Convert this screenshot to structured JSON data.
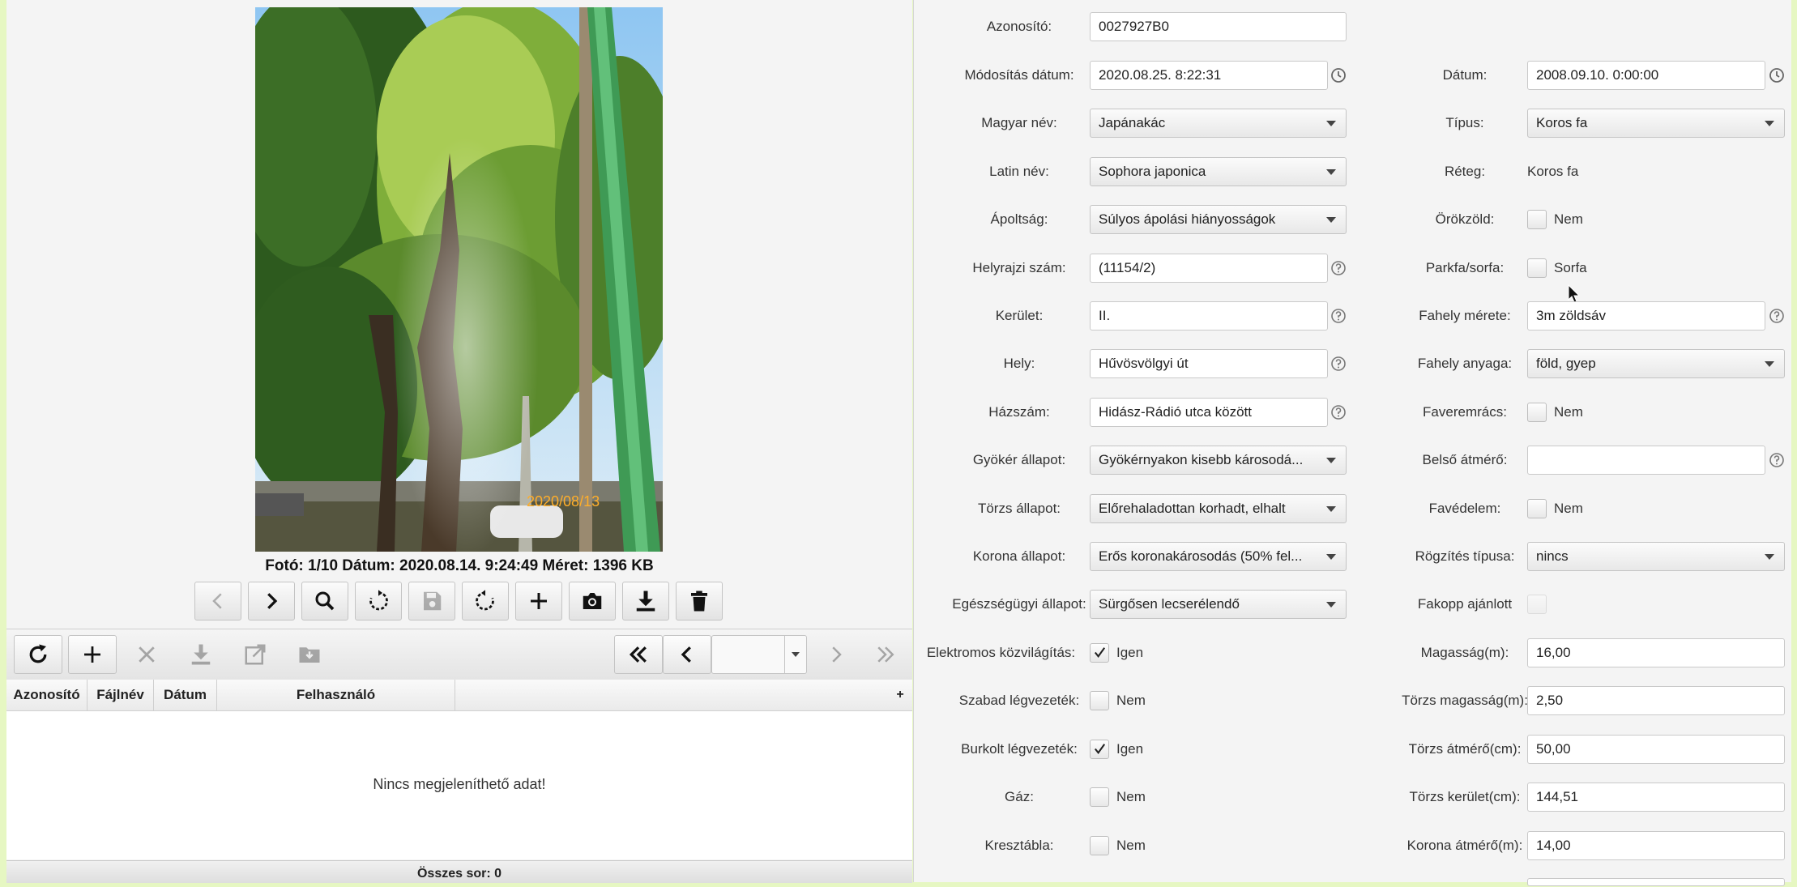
{
  "photo": {
    "stamp": "2020/08/13",
    "caption": "Fotó: 1/10 Dátum: 2020.08.14. 9:24:49 Méret: 1396 KB"
  },
  "photo_toolbar": [
    "chevron-left-icon",
    "chevron-right-icon",
    "search-icon",
    "rotate-right-icon",
    "save-icon",
    "rotate-left-icon",
    "plus-icon",
    "camera-icon",
    "download-icon",
    "trash-icon"
  ],
  "grid": {
    "toolbar_icons": [
      "refresh-icon",
      "plus-icon",
      "close-icon",
      "download-icon",
      "external-link-icon",
      "folder-download-icon"
    ],
    "pager_icons": [
      "double-chevron-left-icon",
      "chevron-left-icon",
      "chevron-right-icon",
      "double-chevron-right-icon"
    ],
    "columns": [
      "Azonosító",
      "Fájlnév",
      "Dátum",
      "Felhasználó"
    ],
    "add_column": "+",
    "empty_text": "Nincs megjeleníthető adat!",
    "footer": "Összes sor: 0"
  },
  "form": {
    "azonosito": {
      "label": "Azonosító:",
      "value": "0027927B0"
    },
    "modositas_datum": {
      "label": "Módosítás dátum:",
      "value": "2020.08.25. 8:22:31"
    },
    "datum": {
      "label": "Dátum:",
      "value": "2008.09.10. 0:00:00"
    },
    "magyar_nev": {
      "label": "Magyar név:",
      "value": "Japánakác"
    },
    "tipus": {
      "label": "Típus:",
      "value": "Koros fa"
    },
    "latin_nev": {
      "label": "Latin név:",
      "value": "Sophora japonica"
    },
    "reteg": {
      "label": "Réteg:",
      "value": "Koros fa"
    },
    "apoltsag": {
      "label": "Ápoltság:",
      "value": "Súlyos ápolási hiányosságok"
    },
    "orokzold": {
      "label": "Örökzöld:",
      "checkbox": "Nem",
      "checked": false
    },
    "helyrajzi_szam": {
      "label": "Helyrajzi szám:",
      "value": "(11154/2)"
    },
    "parkfa_sorfa": {
      "label": "Parkfa/sorfa:",
      "checkbox": "Sorfa",
      "checked": false
    },
    "kerulet": {
      "label": "Kerület:",
      "value": "II."
    },
    "fahely_merete": {
      "label": "Fahely mérete:",
      "value": "3m zöldsáv"
    },
    "hely": {
      "label": "Hely:",
      "value": "Hűvösvölgyi út"
    },
    "fahely_anyaga": {
      "label": "Fahely anyaga:",
      "value": "föld, gyep"
    },
    "hazszam": {
      "label": "Házszám:",
      "value": "Hidász-Rádió utca között"
    },
    "faveremracs": {
      "label": "Faveremrács:",
      "checkbox": "Nem",
      "checked": false
    },
    "gyoker_allapot": {
      "label": "Gyökér állapot:",
      "value": "Gyökérnyakon kisebb károsodá..."
    },
    "belso_atmero": {
      "label": "Belső átmérő:",
      "value": ""
    },
    "torzs_allapot": {
      "label": "Törzs állapot:",
      "value": "Előrehaladottan korhadt, elhalt"
    },
    "favedelem": {
      "label": "Favédelem:",
      "checkbox": "Nem",
      "checked": false
    },
    "korona_allapot": {
      "label": "Korona állapot:",
      "value": "Erős koronakárosodás (50% fel..."
    },
    "rogzites_tipusa": {
      "label": "Rögzítés típusa:",
      "value": "nincs"
    },
    "egeszsegugyi_allapot": {
      "label": "Egészségügyi állapot:",
      "value": "Sürgősen lecserélendő"
    },
    "fakopp_ajanlott": {
      "label": "Fakopp ajánlott",
      "checked": false
    },
    "elektromos_kozvilagitas": {
      "label": "Elektromos közvilágítás:",
      "checkbox": "Igen",
      "checked": true
    },
    "magassag": {
      "label": "Magasság(m):",
      "value": "16,00"
    },
    "szabad_legvezetek": {
      "label": "Szabad légvezeték:",
      "checkbox": "Nem",
      "checked": false
    },
    "torzs_magassag": {
      "label": "Törzs magasság(m):",
      "value": "2,50"
    },
    "burkolt_legvezetek": {
      "label": "Burkolt légvezeték:",
      "checkbox": "Igen",
      "checked": true
    },
    "torzs_atmero": {
      "label": "Törzs átmérő(cm):",
      "value": "50,00"
    },
    "gaz": {
      "label": "Gáz:",
      "checkbox": "Nem",
      "checked": false
    },
    "torzs_kerulet": {
      "label": "Törzs kerület(cm):",
      "value": "144,51"
    },
    "kresztabla": {
      "label": "Kresztábla:",
      "checkbox": "Nem",
      "checked": false
    },
    "korona_atmero": {
      "label": "Korona átmérő(m):",
      "value": "14,00"
    }
  },
  "colors": {
    "accent_green": "#2e8b2e",
    "background": "#f4f4f4",
    "outer": "#e6f7c2"
  }
}
